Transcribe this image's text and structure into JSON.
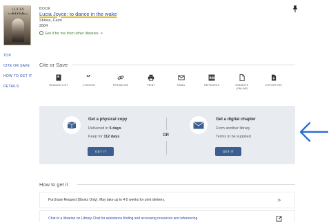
{
  "record": {
    "cover": {
      "title": "LUCIA JOYCE",
      "subtitle": "To Dance in the Wake"
    },
    "type": "BOOK",
    "title": "Lucia Joyce: to dance in the wake",
    "author": "Shloss, Carol",
    "year": "2004",
    "ill_link": "Get it for me from other libraries",
    "ill_chevron": ">"
  },
  "sidenav": {
    "items": [
      {
        "label": "TOP"
      },
      {
        "label": "CITE OR SAVE"
      },
      {
        "label": "HOW TO GET IT"
      },
      {
        "label": "DETAILS"
      }
    ]
  },
  "cite": {
    "heading": "Cite or Save",
    "actions": [
      {
        "label": "READING LIST",
        "icon": "bookmark-icon"
      },
      {
        "label": "CITATION",
        "icon": "quote-icon"
      },
      {
        "label": "PERMALINK",
        "icon": "link-icon"
      },
      {
        "label": "PRINT",
        "icon": "printer-icon"
      },
      {
        "label": "EMAIL",
        "icon": "envelope-icon"
      },
      {
        "label": "REFWORKS",
        "icon": "refworks-icon"
      },
      {
        "label": "ENDNOTE",
        "label2": "(ONLINE)",
        "icon": "document-icon"
      },
      {
        "label": "EXPORT RIS",
        "icon": "download-document-icon"
      }
    ]
  },
  "getit": {
    "physical": {
      "title": "Get a physical copy",
      "line1_prefix": "Delivered in ",
      "line1_value": "5 days",
      "line2_prefix": "Keep for ",
      "line2_value": "112 days",
      "button": "GET IT"
    },
    "or": "OR",
    "digital": {
      "title": "Get a digital chapter",
      "line1": "From another library",
      "line2": "Terms to be supplied",
      "button": "GET IT"
    }
  },
  "howto": {
    "heading": "How to get it",
    "rows": [
      {
        "text": "Purchase Request (Books Only). May take up to 4-5 weeks for print delivery.",
        "chevron": ">"
      },
      {
        "text": "Chat to a librarian on Library Chat for assistance finding and accessing resources and referencing"
      }
    ]
  },
  "colors": {
    "link": "#2b4aa8",
    "button": "#3c5f8f",
    "panel": "#e8ebf0",
    "arrow": "#2a6fd6",
    "ill": "#3f7d2f"
  }
}
